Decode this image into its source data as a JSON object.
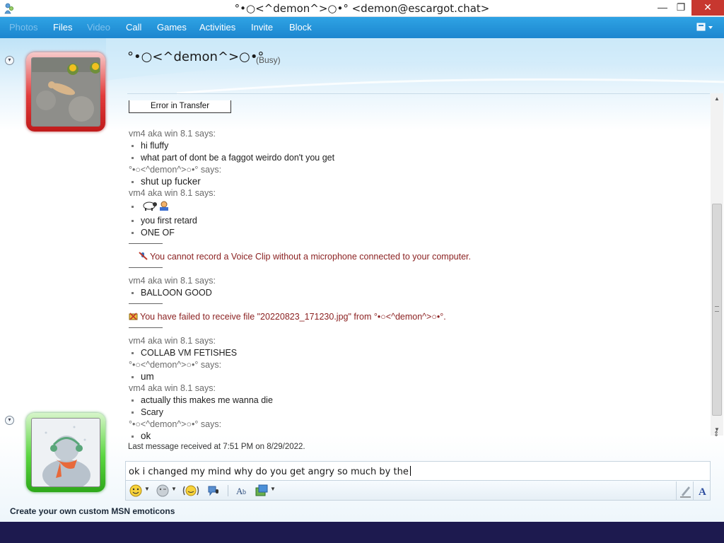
{
  "window": {
    "title": "°•○<^demon^>○•° <demon@escargot.chat>",
    "min_label": "—",
    "max_label": "❐",
    "close_label": "✕"
  },
  "menu": {
    "items": [
      {
        "label": "Photos",
        "enabled": false
      },
      {
        "label": "Files",
        "enabled": true
      },
      {
        "label": "Video",
        "enabled": false
      },
      {
        "label": "Call",
        "enabled": true
      },
      {
        "label": "Games",
        "enabled": true
      },
      {
        "label": "Activities",
        "enabled": true
      },
      {
        "label": "Invite",
        "enabled": true
      },
      {
        "label": "Block",
        "enabled": true
      }
    ],
    "options_icon": "layout-options-icon"
  },
  "contact": {
    "name": "°•○<^demon^>○•°",
    "status": "(Busy)"
  },
  "conversation": {
    "error_button": "Error in Transfer",
    "lines": [
      {
        "kind": "says",
        "text": "vm4 aka win 8.1 says:"
      },
      {
        "kind": "msg",
        "text": "hi fluffy"
      },
      {
        "kind": "msg",
        "text": "what part of dont be a faggot weirdo don't you get"
      },
      {
        "kind": "says",
        "text": "°•○<^demon^>○•° says:"
      },
      {
        "kind": "msg-big",
        "text": "shut up fucker"
      },
      {
        "kind": "says",
        "text": "vm4 aka win 8.1 says:"
      },
      {
        "kind": "emoticon",
        "text": ""
      },
      {
        "kind": "msg",
        "text": "you first retard"
      },
      {
        "kind": "msg",
        "text": "ONE OF"
      },
      {
        "kind": "sys",
        "text": "You cannot record a Voice Clip without a microphone connected to your computer."
      },
      {
        "kind": "says",
        "text": "vm4 aka win 8.1 says:"
      },
      {
        "kind": "msg",
        "text": "BALLOON GOOD"
      },
      {
        "kind": "sys2",
        "text": "You have failed to receive file \"20220823_171230.jpg\" from °•○<^demon^>○•°."
      },
      {
        "kind": "says",
        "text": "vm4 aka win 8.1 says:"
      },
      {
        "kind": "msg",
        "text": "COLLAB VM FETISHES"
      },
      {
        "kind": "says",
        "text": "°•○<^demon^>○•° says:"
      },
      {
        "kind": "msg-big",
        "text": "um"
      },
      {
        "kind": "says",
        "text": "vm4 aka win 8.1 says:"
      },
      {
        "kind": "msg",
        "text": "actually this makes me wanna die"
      },
      {
        "kind": "msg",
        "text": "Scary"
      },
      {
        "kind": "says",
        "text": "°•○<^demon^>○•° says:"
      },
      {
        "kind": "msg-big",
        "text": "ok"
      }
    ],
    "last_message": "Last message received at 7:51 PM on 8/29/2022."
  },
  "compose": {
    "text": "ok i changed my mind why do you get angry so much by the",
    "toolbar_icons": [
      "emoticon-icon",
      "wink-icon",
      "nudge-icon",
      "voice-clip-icon",
      "font-icon",
      "background-icon"
    ]
  },
  "footer": {
    "link": "Create your own custom MSN emoticons"
  },
  "colors": {
    "menubar": "#1c86cf",
    "busy_frame": "#e23c3c",
    "online_frame": "#5ad63f",
    "system_text": "#8a1f1f",
    "taskbar": "#1d1a4f"
  }
}
